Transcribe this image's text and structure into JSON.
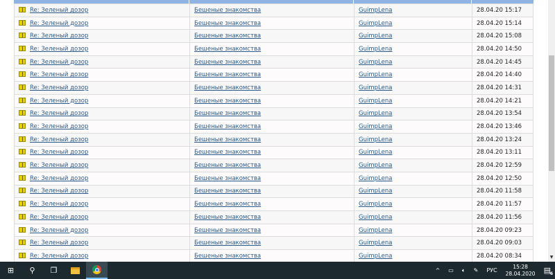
{
  "rows": [
    {
      "topic": "Re: Зеленый дозор",
      "forum": "Бешеные знакомства",
      "author": "GuimpLena",
      "date": "28.04.20 15:17"
    },
    {
      "topic": "Re: Зеленый дозор",
      "forum": "Бешеные знакомства",
      "author": "GuimpLena",
      "date": "28.04.20 15:14"
    },
    {
      "topic": "Re: Зеленый дозор",
      "forum": "Бешеные знакомства",
      "author": "GuimpLena",
      "date": "28.04.20 15:08"
    },
    {
      "topic": "Re: Зеленый дозор",
      "forum": "Бешеные знакомства",
      "author": "GuimpLena",
      "date": "28.04.20 14:50"
    },
    {
      "topic": "Re: Зеленый дозор",
      "forum": "Бешеные знакомства",
      "author": "GuimpLena",
      "date": "28.04.20 14:45"
    },
    {
      "topic": "Re: Зеленый дозор",
      "forum": "Бешеные знакомства",
      "author": "GuimpLena",
      "date": "28.04.20 14:40"
    },
    {
      "topic": "Re: Зеленый дозор",
      "forum": "Бешеные знакомства",
      "author": "GuimpLena",
      "date": "28.04.20 14:31"
    },
    {
      "topic": "Re: Зеленый дозор",
      "forum": "Бешеные знакомства",
      "author": "GuimpLena",
      "date": "28.04.20 14:21"
    },
    {
      "topic": "Re: Зеленый дозор",
      "forum": "Бешеные знакомства",
      "author": "GuimpLena",
      "date": "28.04.20 13:54"
    },
    {
      "topic": "Re: Зеленый дозор",
      "forum": "Бешеные знакомства",
      "author": "GuimpLena",
      "date": "28.04.20 13:46"
    },
    {
      "topic": "Re: Зеленый дозор",
      "forum": "Бешеные знакомства",
      "author": "GuimpLena",
      "date": "28.04.20 13:24"
    },
    {
      "topic": "Re: Зеленый дозор",
      "forum": "Бешеные знакомства",
      "author": "GuimpLena",
      "date": "28.04.20 13:11"
    },
    {
      "topic": "Re: Зеленый дозор",
      "forum": "Бешеные знакомства",
      "author": "GuimpLena",
      "date": "28.04.20 12:59"
    },
    {
      "topic": "Re: Зеленый дозор",
      "forum": "Бешеные знакомства",
      "author": "GuimpLena",
      "date": "28.04.20 12:50"
    },
    {
      "topic": "Re: Зеленый дозор",
      "forum": "Бешеные знакомства",
      "author": "GuimpLena",
      "date": "28.04.20 11:58"
    },
    {
      "topic": "Re: Зеленый дозор",
      "forum": "Бешеные знакомства",
      "author": "GuimpLena",
      "date": "28.04.20 11:57"
    },
    {
      "topic": "Re: Зеленый дозор",
      "forum": "Бешеные знакомства",
      "author": "GuimpLena",
      "date": "28.04.20 11:56"
    },
    {
      "topic": "Re: Зеленый дозор",
      "forum": "Бешеные знакомства",
      "author": "GuimpLena",
      "date": "28.04.20 09:23"
    },
    {
      "topic": "Re: Зеленый дозор",
      "forum": "Бешеные знакомства",
      "author": "GuimpLena",
      "date": "28.04.20 09:03"
    },
    {
      "topic": "Re: Зеленый дозор",
      "forum": "Бешеные знакомства",
      "author": "GuimpLena",
      "date": "28.04.20 08:34"
    }
  ],
  "taskbar": {
    "lang": "РУС",
    "time": "15:28",
    "date": "28.04.2020",
    "notifications": "6"
  },
  "colors": {
    "header": "#8fb4e3",
    "link": "#2a5a8c",
    "taskbar": "#1c2a30"
  }
}
